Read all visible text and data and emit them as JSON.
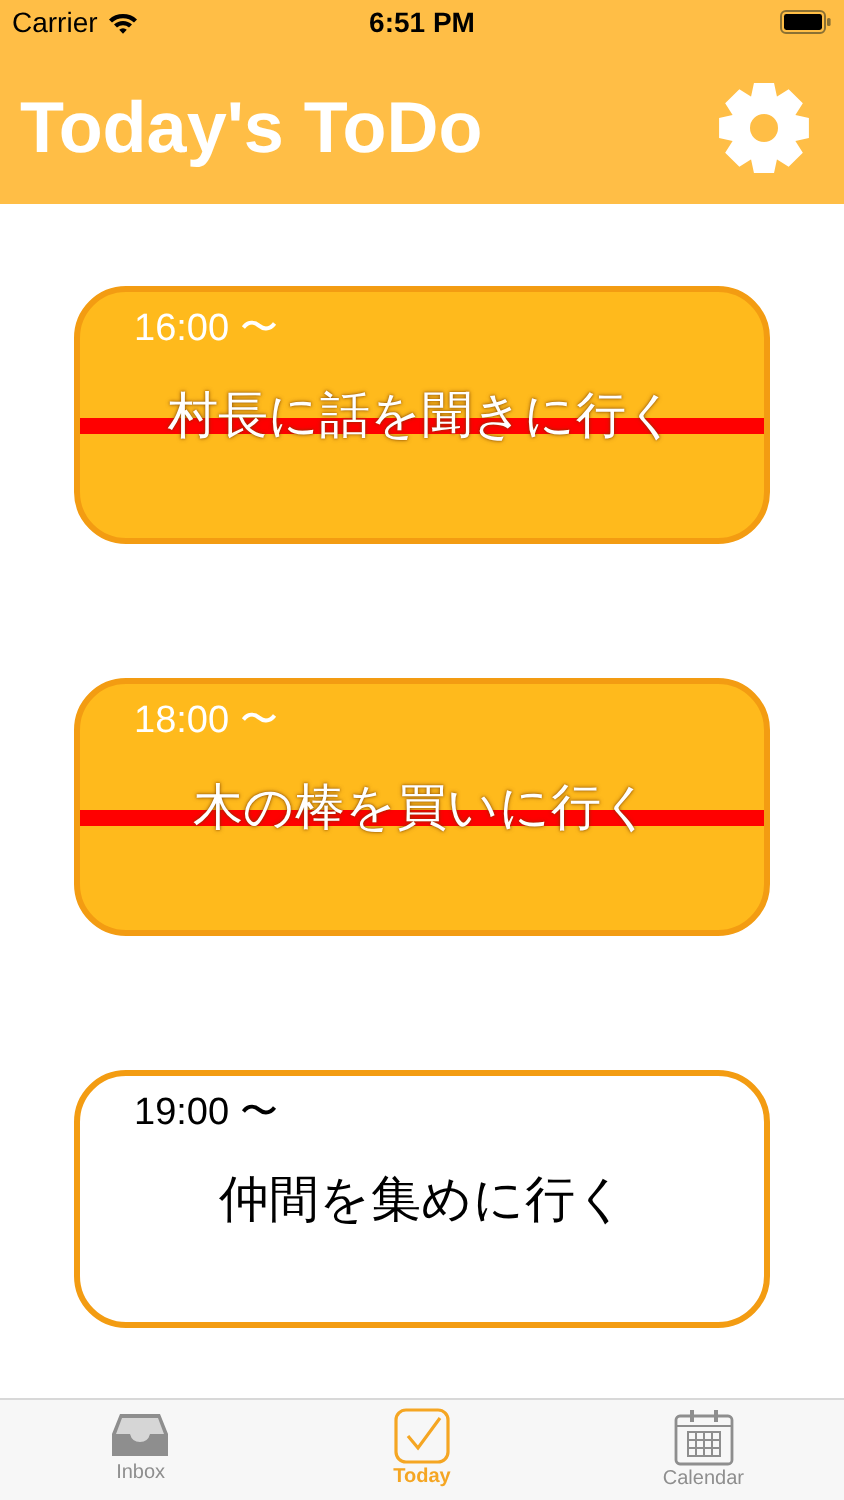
{
  "status_bar": {
    "carrier": "Carrier",
    "time": "6:51 PM"
  },
  "nav_bar": {
    "title": "Today's ToDo"
  },
  "todos": [
    {
      "time": "16:00 〜",
      "title": "村長に話を聞きに行く",
      "done": true
    },
    {
      "time": "18:00 〜",
      "title": "木の棒を買いに行く",
      "done": true
    },
    {
      "time": "19:00 〜",
      "title": "仲間を集めに行く",
      "done": false
    }
  ],
  "tab_bar": [
    {
      "kind": "inbox",
      "label": "Inbox",
      "selected": false
    },
    {
      "kind": "today",
      "label": "Today",
      "selected": true
    },
    {
      "kind": "calendar",
      "label": "Calendar",
      "selected": false
    }
  ]
}
